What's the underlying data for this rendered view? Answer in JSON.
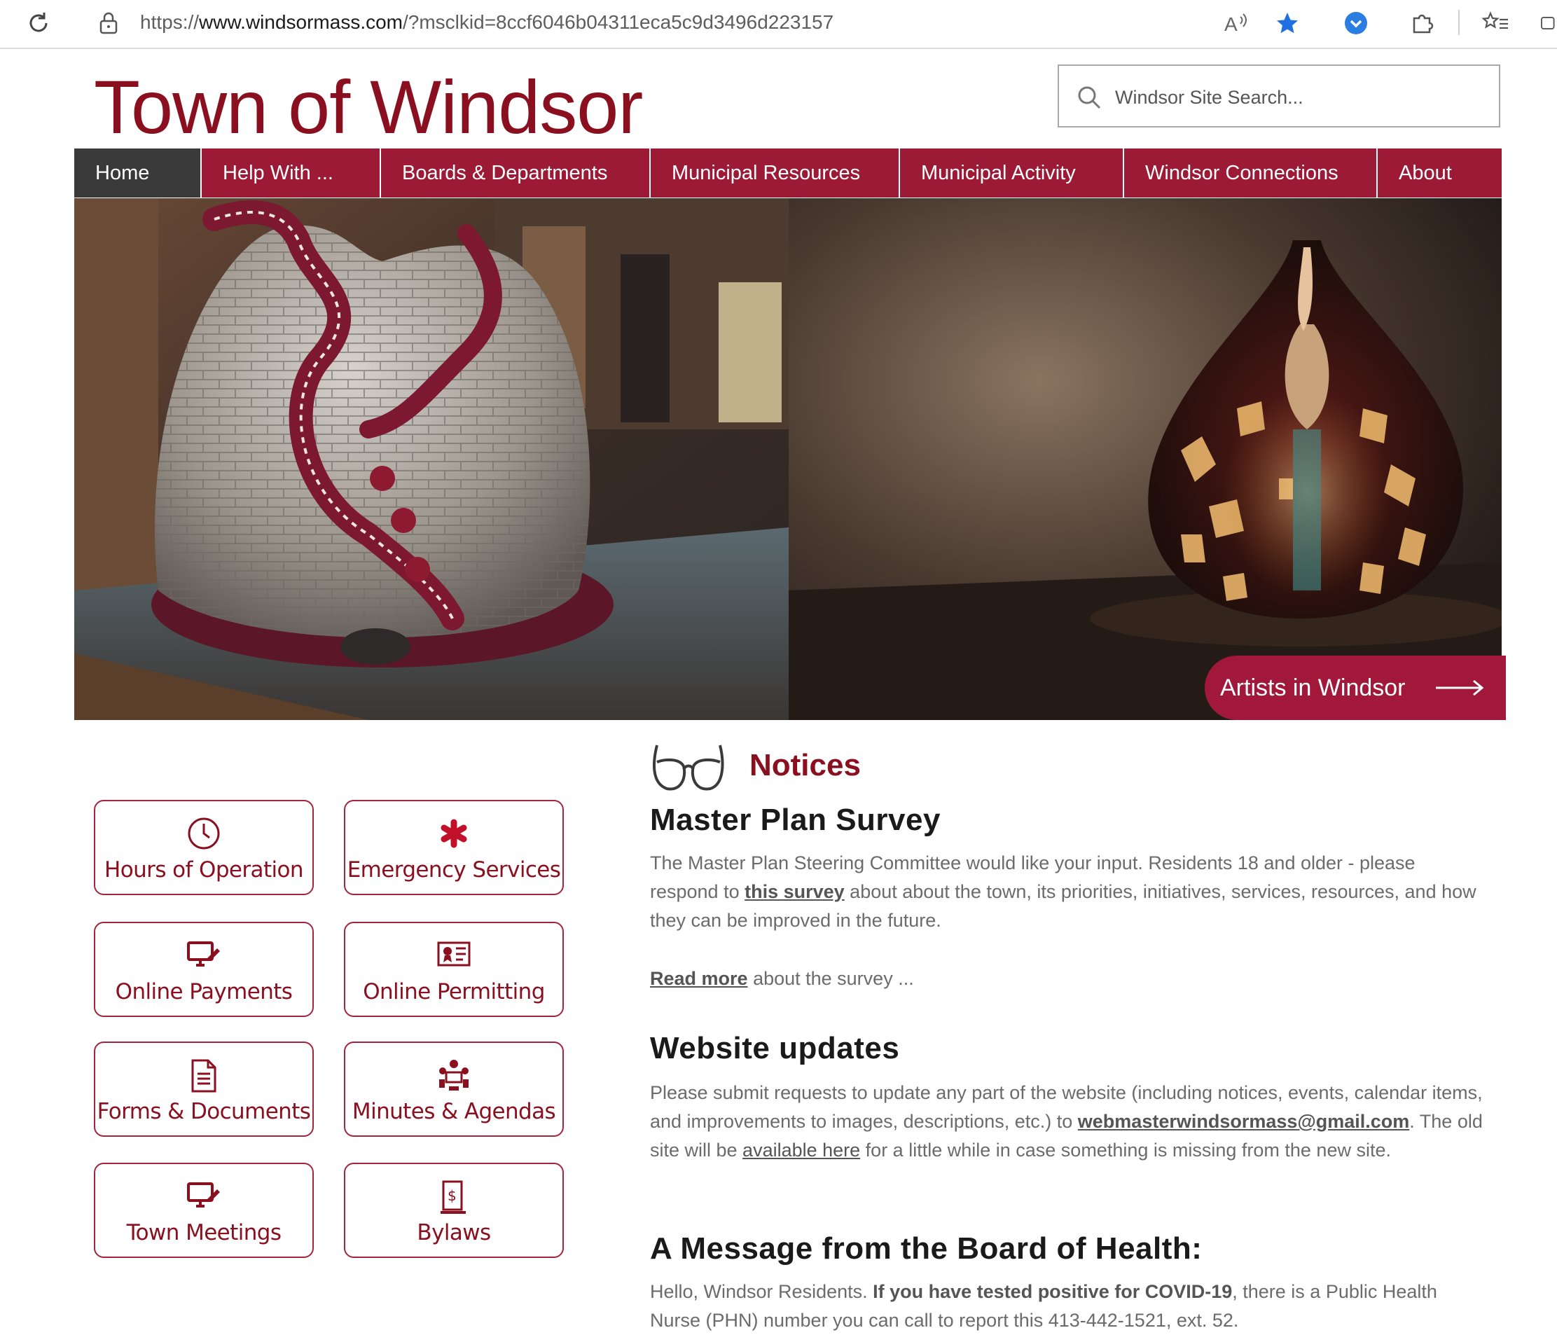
{
  "browser": {
    "url_prefix": "https://",
    "url_host": "www.windsormass.com",
    "url_path": "/?msclkid=8ccf6046b04311eca5c9d3496d223157"
  },
  "site": {
    "title": "Town of Windsor"
  },
  "search": {
    "placeholder": "Windsor Site Search..."
  },
  "nav": {
    "items": [
      {
        "label": "Home"
      },
      {
        "label": "Help With ..."
      },
      {
        "label": "Boards & Departments"
      },
      {
        "label": "Municipal Resources"
      },
      {
        "label": "Municipal Activity"
      },
      {
        "label": "Windsor Connections"
      },
      {
        "label": "About"
      }
    ]
  },
  "hero": {
    "cta_label": "Artists in Windsor"
  },
  "quick_links": [
    {
      "label": "Hours of Operation",
      "icon": "clock-icon"
    },
    {
      "label": "Emergency Services",
      "icon": "asterisk-icon"
    },
    {
      "label": "Online Payments",
      "icon": "monitor-pen-icon"
    },
    {
      "label": "Online Permitting",
      "icon": "certificate-icon"
    },
    {
      "label": "Forms & Documents",
      "icon": "document-icon"
    },
    {
      "label": "Minutes & Agendas",
      "icon": "meeting-icon"
    },
    {
      "label": "Town Meetings",
      "icon": "monitor-pen-icon"
    },
    {
      "label": "Bylaws",
      "icon": "bylaws-icon"
    }
  ],
  "notices": {
    "heading": "Notices",
    "items": [
      {
        "title": "Master Plan Survey",
        "p1_a": "The Master Plan Steering Committee would like your input. Residents 18 and older - please respond to ",
        "p1_link": "this survey",
        "p1_b": " about about the town, its priorities, initiatives, services, resources, and how they can be improved in the future.",
        "p2_link": "Read more",
        "p2_b": " about the survey ..."
      },
      {
        "title": "Website updates",
        "p1_a": "Please submit requests to update any part of the website (including notices, events, calendar items, and improvements to images, descriptions, etc.) to ",
        "p1_email": "webmasterwindsormass@gmail.com",
        "p1_b": ". The old site will be ",
        "p1_link2": "available here",
        "p1_c": " for a little while in case something is missing from the new site."
      },
      {
        "title": "A Message from the Board of Health:",
        "p1_a": "Hello, Windsor Residents. ",
        "p1_bold": "If you have tested positive for COVID-19",
        "p1_b": ", there is a Public Health Nurse (PHN) number you can call to report this 413-442-1521, ext. 52."
      }
    ]
  },
  "colors": {
    "brand": "#9c1a35",
    "title": "#8a1020",
    "nav_active": "#3a3a3a"
  }
}
